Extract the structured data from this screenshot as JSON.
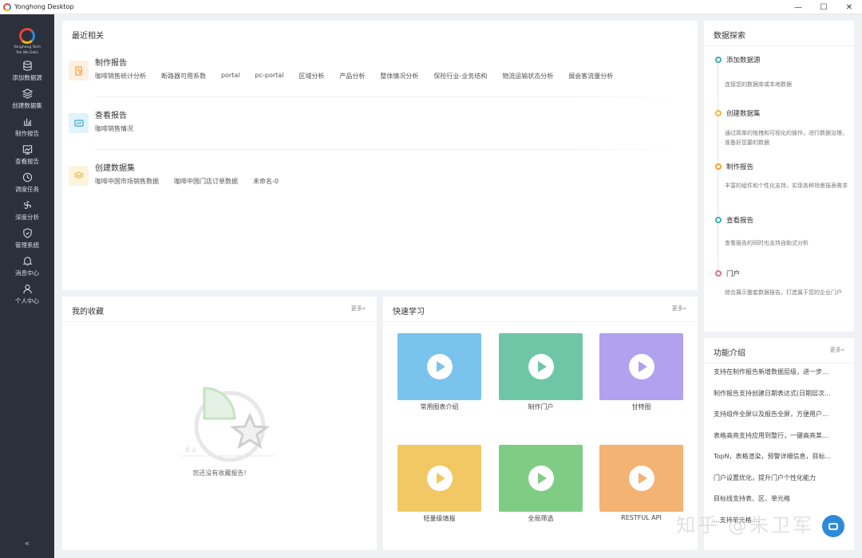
{
  "window": {
    "title": "Yonghong Desktop",
    "controls": [
      "—",
      "☐",
      "✕"
    ]
  },
  "sidebar": {
    "brand": "Yonghong Tech",
    "brand_sub": "Yes We Data",
    "items": [
      {
        "label": "添加数据源",
        "icon": "database-icon"
      },
      {
        "label": "创建数据集",
        "icon": "dataset-icon"
      },
      {
        "label": "制作报告",
        "icon": "bar-chart-icon"
      },
      {
        "label": "查看报告",
        "icon": "report-view-icon"
      },
      {
        "label": "调度任务",
        "icon": "clock-icon"
      },
      {
        "label": "深度分析",
        "icon": "fan-icon"
      },
      {
        "label": "管理系统",
        "icon": "shield-icon"
      },
      {
        "label": "消息中心",
        "icon": "bell-icon"
      },
      {
        "label": "个人中心",
        "icon": "user-icon"
      }
    ],
    "collapse": "«"
  },
  "recent": {
    "title": "最近相关",
    "rows": [
      {
        "title": "制作报告",
        "color": "#f6a23a",
        "bg": "#fdf0e2",
        "links": [
          "咖啡销售统计分析",
          "断路器可用系数",
          "portal",
          "pc-portal",
          "区域分析",
          "产品分析",
          "整体情况分析",
          "保险行业-业务结构",
          "物流运输状态分析",
          "展会客流量分析"
        ]
      },
      {
        "title": "查看报告",
        "color": "#3ca9d7",
        "bg": "#e1f3fb",
        "links": [
          "咖啡销售情况"
        ]
      },
      {
        "title": "创建数据集",
        "color": "#efb844",
        "bg": "#fdf4dc",
        "links": [
          "咖啡中国市场销售数据",
          "咖啡中国门店订单数据",
          "未命名-0"
        ]
      }
    ]
  },
  "favorites": {
    "title": "我的收藏",
    "more": "更多»",
    "empty_text": "您还没有收藏报告!"
  },
  "learning": {
    "title": "快速学习",
    "more": "更多»",
    "cards": [
      {
        "label": "常用图表介绍",
        "color": "#79c3ec"
      },
      {
        "label": "制作门户",
        "color": "#6fc6a7"
      },
      {
        "label": "甘特图",
        "color": "#b1a1ef"
      },
      {
        "label": "轻量级填报",
        "color": "#f2c865"
      },
      {
        "label": "全局筛选",
        "color": "#7fcd84"
      },
      {
        "label": "RESTFUL API",
        "color": "#f4b273"
      }
    ]
  },
  "explore": {
    "title": "数据探索",
    "steps": [
      {
        "title": "添加数据源",
        "desc": "连接您的数据库或本地数据",
        "color": "#38b2a8"
      },
      {
        "title": "创建数据集",
        "desc": "通过简单的拖拽和可视化的操作，进行数据治理，准备好您要的数据",
        "color": "#efb844"
      },
      {
        "title": "制作报告",
        "desc": "丰富的组件和个性化支持，实现各种场景报表需求",
        "color": "#f6a23a"
      },
      {
        "title": "查看报告",
        "desc": "查看报告的同时也支持自助式分析",
        "color": "#38b2a8"
      },
      {
        "title": "门户",
        "desc": "综合展示整套数据报告，打造属于您的企业门户",
        "color": "#e0708a"
      }
    ]
  },
  "features": {
    "title": "功能介绍",
    "more": "更多»",
    "items": [
      "支持在制作报告新增数据层级，进一步...",
      "制作报告支持创建日期表达式(日期层次...",
      "支持组件全屏以及报告全屏，方便用户...",
      "表格高亮支持应用到整行，一键高亮某...",
      "TopN，表格渲染，预警详细信息，目标...",
      "门户设置优化，提升门户个性化能力",
      "目标线支持表、区、单元格",
      "...支持单元格 ..."
    ]
  },
  "watermark": "知乎 @朱卫军"
}
